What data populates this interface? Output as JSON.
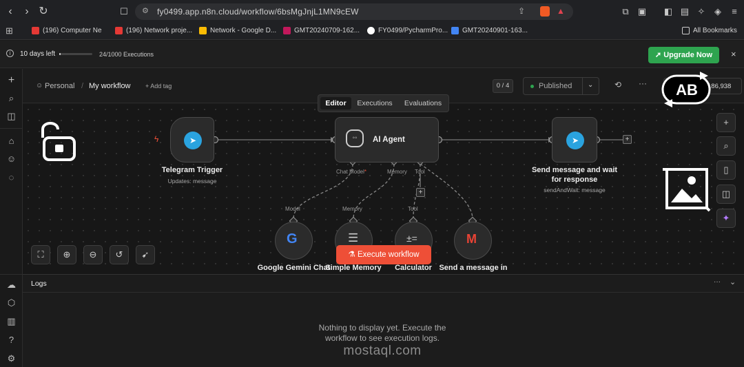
{
  "browser": {
    "url": "fy0499.app.n8n.cloud/workflow/6bsMgJnjL1MN9cEW",
    "bookmarks": [
      {
        "label": "(196) Computer Ne",
        "color": "#e53935"
      },
      {
        "label": "(196) Network proje...",
        "color": "#e53935"
      },
      {
        "label": "Network - Google D...",
        "color": "#fbbc04"
      },
      {
        "label": "GMT20240709-162...",
        "color": "#c2185b"
      },
      {
        "label": "FY0499/PycharmPro...",
        "color": "#ffffff"
      },
      {
        "label": "GMT20240901-163...",
        "color": "#4285f4"
      }
    ],
    "all_bookmarks": "All Bookmarks"
  },
  "banner": {
    "trial_days": "10 days left",
    "executions": "24/1000 Executions",
    "upgrade_label": "Upgrade Now",
    "trial_progress": 0.024
  },
  "header": {
    "breadcrumb_owner": "Personal",
    "breadcrumb_sep": "/",
    "workflow_name": "My workflow",
    "add_tag": "+ Add tag",
    "counter": "0 / 4",
    "published_label": "Published",
    "star_count": "186,938"
  },
  "tabs": [
    {
      "label": "Editor",
      "active": true
    },
    {
      "label": "Executions",
      "active": false
    },
    {
      "label": "Evaluations",
      "active": false
    }
  ],
  "nodes": {
    "telegram_trigger": {
      "label": "Telegram Trigger",
      "sub": "Updates: message"
    },
    "ai_agent": {
      "label": "AI Agent",
      "handles": [
        "Chat Model",
        "Memory",
        "Tool"
      ],
      "chat_model_required": "*"
    },
    "send_message": {
      "label_line1": "Send message and wait",
      "label_line2": "for response",
      "sub": "sendAndWait: message"
    },
    "gemini": {
      "label": "Google Gemini Chat",
      "handle": "Model"
    },
    "memory": {
      "label": "Simple Memory",
      "handle": "Memory"
    },
    "calculator": {
      "label": "Calculator",
      "handle": "Tool"
    },
    "gmail": {
      "label": "Send a message in"
    }
  },
  "execute_label": "Execute workflow",
  "logs": {
    "title": "Logs",
    "empty_line1": "Nothing to display yet. Execute the",
    "empty_line2": "workflow to see execution logs."
  },
  "watermark": {
    "domain": "mostaql.com",
    "overlay": "AB"
  },
  "colors": {
    "upgrade_green": "#2ea44f",
    "execute_orange": "#ee4f37",
    "telegram_blue": "#2aa3df",
    "published_green": "#2ea44f"
  }
}
